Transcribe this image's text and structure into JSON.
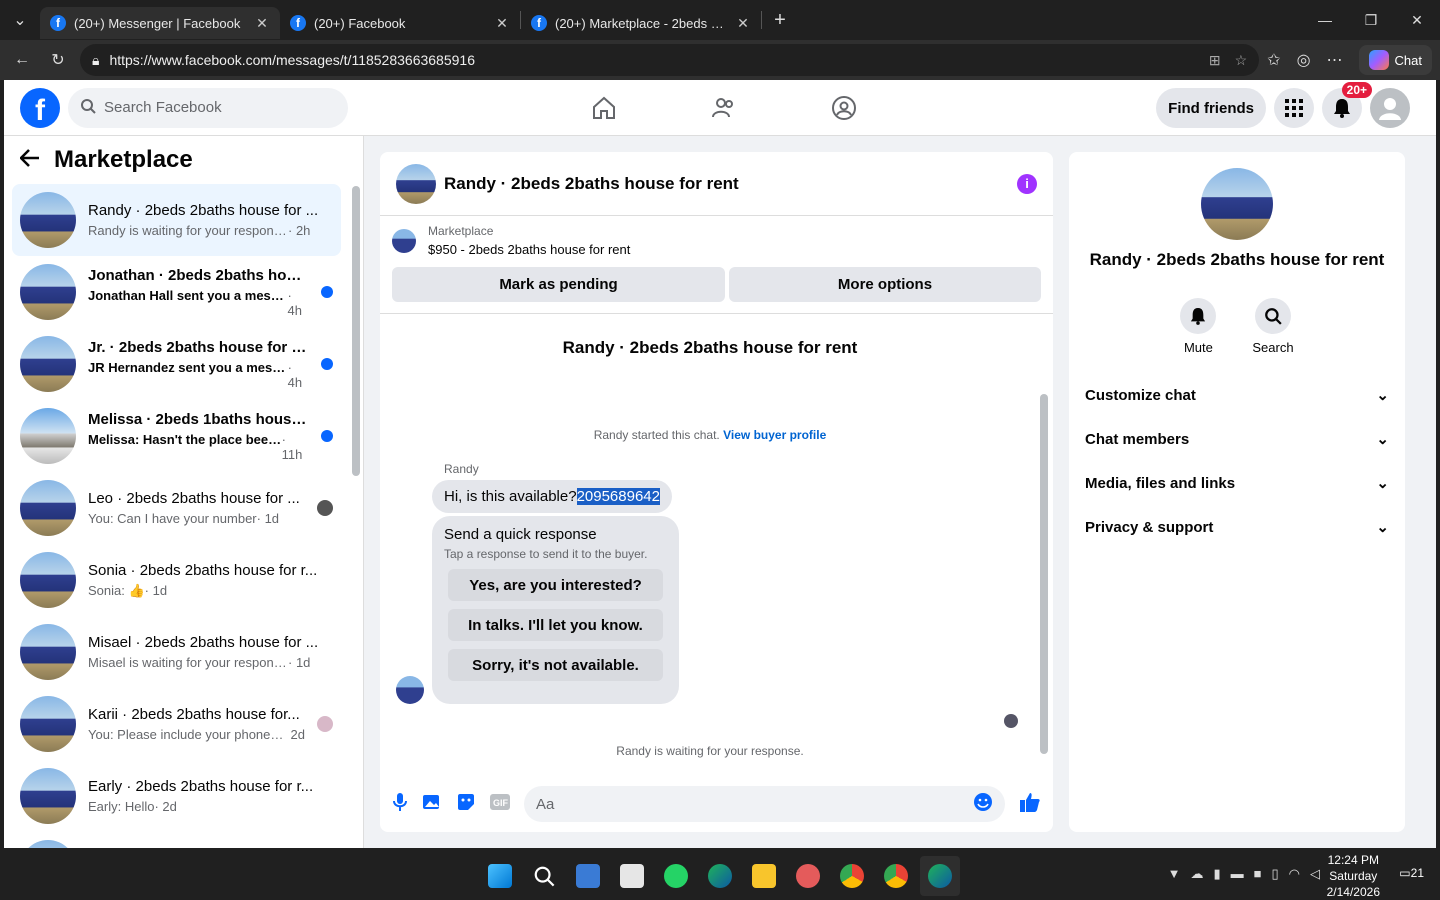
{
  "browser": {
    "tabs": [
      {
        "title": "(20+) Messenger | Facebook",
        "active": true
      },
      {
        "title": "(20+) Facebook",
        "active": false
      },
      {
        "title": "(20+) Marketplace - 2beds 2baths",
        "active": false
      }
    ],
    "url": "https://www.facebook.com/messages/t/1185283663685916",
    "copilot_label": "Chat"
  },
  "fb_header": {
    "search_placeholder": "Search Facebook",
    "find_friends": "Find friends",
    "notif_badge": "20+"
  },
  "sidebar": {
    "title": "Marketplace",
    "conversations": [
      {
        "name": "Randy · 2beds 2baths house for ...",
        "sub": "Randy is waiting for your response.",
        "time": "· 2h",
        "unread": false,
        "selected": true
      },
      {
        "name": "Jonathan · 2beds 2baths hous...",
        "sub": "Jonathan Hall sent you a messa...",
        "time": "· 4h",
        "unread": true
      },
      {
        "name": "Jr. · 2beds 2baths house for rent",
        "sub": "JR Hernandez sent you a messa...",
        "time": "· 4h",
        "unread": true
      },
      {
        "name": "Melissa · 2beds 1baths house f...",
        "sub": "Melissa: Hasn't the place been ...",
        "time": "· 11h",
        "unread": true
      },
      {
        "name": "Leo · 2beds 2baths house for ...",
        "sub": "You: Can I have your number",
        "time": "· 1d",
        "unread": false
      },
      {
        "name": "Sonia · 2beds 2baths house for r...",
        "sub": "Sonia: 👍",
        "time": "· 1d",
        "unread": false
      },
      {
        "name": "Misael · 2beds 2baths house for ...",
        "sub": "Misael is waiting for your response.",
        "time": "· 1d",
        "unread": false
      },
      {
        "name": "Karii · 2beds 2baths house for...",
        "sub": "You: Please include your phone ...",
        "time": "2d",
        "unread": false
      },
      {
        "name": "Early · 2beds 2baths house for r...",
        "sub": "Early: Hello",
        "time": "· 2d",
        "unread": false
      }
    ]
  },
  "chat": {
    "title": "Randy · 2beds 2baths house for rent",
    "marketplace_label": "Marketplace",
    "listing": "$950 - 2beds 2baths house for rent",
    "mark_pending": "Mark as pending",
    "more_options": "More options",
    "peer_name": "Randy · 2beds 2baths house for rent",
    "started": "Randy started this chat.",
    "view_buyer": "View buyer profile",
    "sender": "Randy",
    "message_text": "Hi, is this available?",
    "message_highlight": "2095689642",
    "quick_title": "Send a quick response",
    "quick_sub": "Tap a response to send it to the buyer.",
    "quick_options": [
      "Yes, are you interested?",
      "In talks. I'll let you know.",
      "Sorry, it's not available."
    ],
    "waiting": "Randy is waiting for your response.",
    "composer_placeholder": "Aa"
  },
  "details": {
    "name": "Randy · 2beds 2baths house for rent",
    "mute": "Mute",
    "search": "Search",
    "sections": [
      "Customize chat",
      "Chat members",
      "Media, files and links",
      "Privacy & support"
    ]
  },
  "taskbar": {
    "time": "12:24 PM",
    "day": "Saturday",
    "date": "2/14/2026",
    "notif_count": "21"
  }
}
